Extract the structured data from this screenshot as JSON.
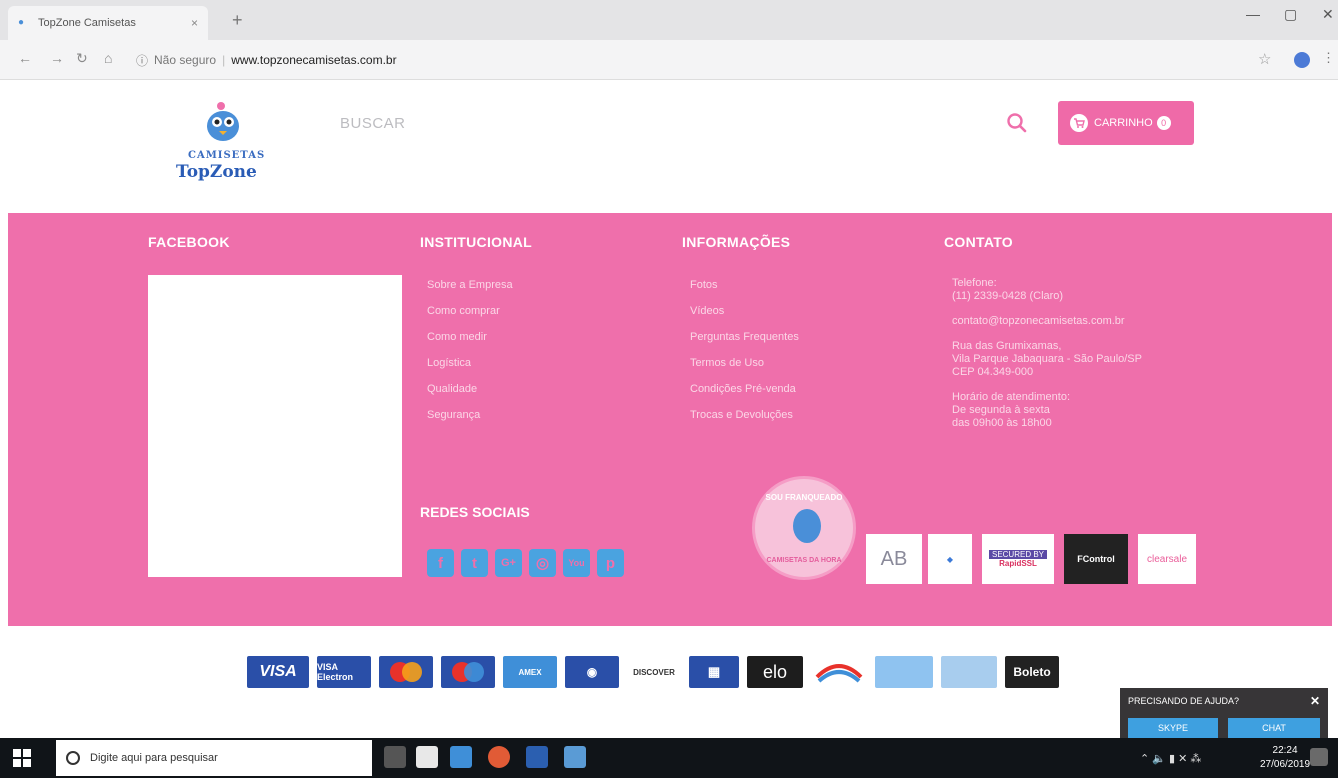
{
  "browser": {
    "tab_title": "TopZone Camisetas",
    "tab_close": "×",
    "new_tab": "+",
    "security_label": "Não seguro",
    "url": "www.topzonecamisetas.com.br"
  },
  "header": {
    "logo_line1": "CAMISETAS",
    "logo_line2": "TopZone",
    "search_placeholder": "BUSCAR",
    "cart_label": "CARRINHO",
    "cart_count": "0"
  },
  "footer": {
    "facebook_heading": "FACEBOOK",
    "institucional_heading": "INSTITUCIONAL",
    "institucional_links": [
      "Sobre a Empresa",
      "Como comprar",
      "Como medir",
      "Logística",
      "Qualidade",
      "Segurança"
    ],
    "informacoes_heading": "INFORMAÇÕES",
    "informacoes_links": [
      "Fotos",
      "Vídeos",
      "Perguntas Frequentes",
      "Termos de Uso",
      "Condições Pré-venda",
      "Trocas e Devoluções"
    ],
    "contato_heading": "CONTATO",
    "phone_label": "Telefone:",
    "phone": "(11) 2339-0428 (Claro)",
    "email": "contato@topzonecamisetas.com.br",
    "address_line1": "Rua das Grumixamas,",
    "address_line2": "Vila Parque Jabaquara - São Paulo/SP",
    "address_line3": "CEP 04.349-000",
    "hours_label": "Horário de atendimento:",
    "hours_line1": "De segunda à sexta",
    "hours_line2": "das 09h00 às 18h00",
    "redes_heading": "REDES SOCIAIS",
    "social_icons": [
      "facebook-icon",
      "twitter-icon",
      "google-plus-icon",
      "instagram-icon",
      "youtube-icon",
      "pinterest-icon"
    ],
    "franquia_top": "SOU FRANQUEADO",
    "franquia_bottom": "CAMISETAS DA HORA",
    "seals": {
      "ab": "AB",
      "ssl_top": "SECURED BY",
      "ssl_name": "RapidSSL",
      "fc": "FControl",
      "clearsale": "clearsale"
    }
  },
  "payments": {
    "visa": "VISA",
    "visa_electron": "VISA Electron",
    "discover": "DISCOVER",
    "elo": "elo",
    "boleto": "Boleto"
  },
  "chat": {
    "title": "PRECISANDO DE AJUDA?",
    "skype": "SKYPE",
    "chat": "CHAT"
  },
  "taskbar": {
    "search_text": "Digite aqui para pesquisar",
    "time": "22:24",
    "date": "27/06/2019"
  },
  "colors": {
    "brand_pink": "#ef6fab",
    "social_blue": "#4aa3e0"
  }
}
